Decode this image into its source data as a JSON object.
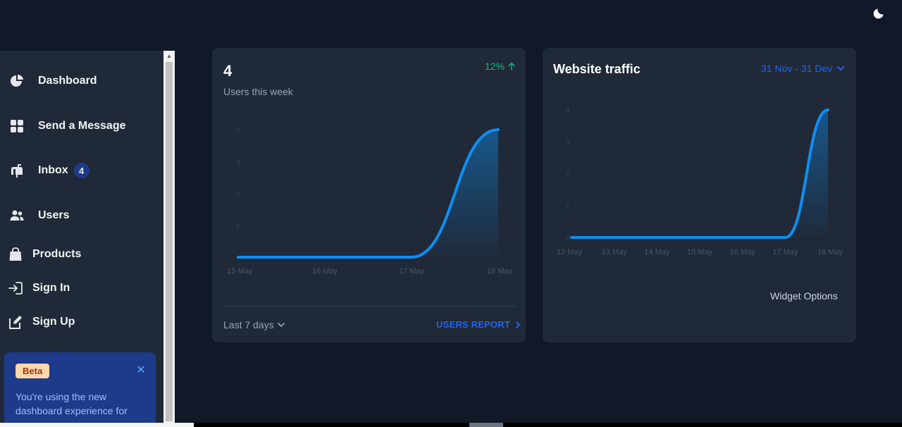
{
  "header": {
    "theme_icon": "moon-icon"
  },
  "sidebar": {
    "items": [
      {
        "label": "Dashboard",
        "icon": "pie-chart-icon"
      },
      {
        "label": "Send a Message",
        "icon": "grid-icon"
      },
      {
        "label": "Inbox",
        "icon": "mailbox-icon",
        "badge": "4"
      },
      {
        "label": "Users",
        "icon": "users-icon"
      },
      {
        "label": "Products",
        "icon": "shopping-bag-icon"
      },
      {
        "label": "Sign In",
        "icon": "sign-in-icon"
      },
      {
        "label": "Sign Up",
        "icon": "edit-icon"
      }
    ],
    "beta": {
      "badge": "Beta",
      "text": "You're using the new dashboard experience for"
    }
  },
  "users_card": {
    "value": "4",
    "subtitle": "Users this week",
    "change": "12%",
    "range_label": "Last 7 days",
    "report_label": "USERS REPORT"
  },
  "traffic_card": {
    "title": "Website traffic",
    "date_range": "31 Nov - 31 Dev",
    "options_label": "Widget Options"
  },
  "colors": {
    "accent": "#1c64f2",
    "line": "#0e8ff2",
    "positive": "#10b981"
  },
  "chart_data": [
    {
      "type": "area",
      "x": [
        "15 May",
        "16 May",
        "17 May",
        "18 May"
      ],
      "series": [
        {
          "values": [
            0,
            0,
            0,
            4
          ]
        }
      ],
      "yticks": [
        "1",
        "2",
        "3",
        "4"
      ],
      "ylim": [
        0,
        4
      ],
      "grid": false
    },
    {
      "type": "area",
      "x": [
        "12 May",
        "13 May",
        "14 May",
        "15 May",
        "16 May",
        "17 May",
        "18 May"
      ],
      "series": [
        {
          "values": [
            0,
            0,
            0,
            0,
            0,
            0,
            4
          ]
        }
      ],
      "yticks": [
        "0",
        "1",
        "2",
        "3",
        "4"
      ],
      "ylim": [
        0,
        4
      ],
      "grid": false
    }
  ]
}
